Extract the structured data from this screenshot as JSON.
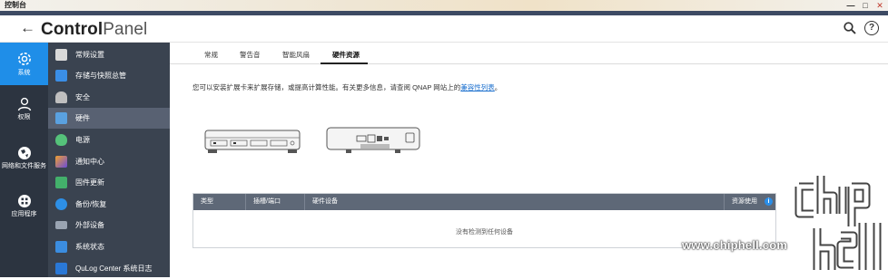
{
  "window": {
    "title": "控制台",
    "minimize": "—",
    "maximize": "□",
    "close": "✕"
  },
  "header": {
    "back_icon": "←",
    "title_bold": "Control",
    "title_light": "Panel",
    "help_label": "?"
  },
  "rail": [
    {
      "label": "系统",
      "icon": "gear-icon",
      "active": true
    },
    {
      "label": "权限",
      "icon": "user-icon",
      "active": false
    },
    {
      "label": "网络和文件服务",
      "icon": "globe-icon",
      "active": false
    },
    {
      "label": "应用程序",
      "icon": "apps-grid-icon",
      "active": false
    }
  ],
  "subnav": [
    {
      "label": "常规设置",
      "icon": "general-settings-icon",
      "color": "#d9d9d9"
    },
    {
      "label": "存储与快照总管",
      "icon": "storage-icon",
      "color": "#3a8ee6"
    },
    {
      "label": "安全",
      "icon": "lock-icon",
      "color": "#bfbfbf"
    },
    {
      "label": "硬件",
      "icon": "hardware-icon",
      "color": "#5aa1e0",
      "active": true
    },
    {
      "label": "电源",
      "icon": "power-icon",
      "color": "#55c27a"
    },
    {
      "label": "通知中心",
      "icon": "notification-icon",
      "color": "#f0a030"
    },
    {
      "label": "固件更新",
      "icon": "firmware-icon",
      "color": "#43b06b"
    },
    {
      "label": "备份/恢复",
      "icon": "backup-icon",
      "color": "#2d8fe6"
    },
    {
      "label": "外部设备",
      "icon": "external-device-icon",
      "color": "#9aa4b2"
    },
    {
      "label": "系统状态",
      "icon": "system-status-icon",
      "color": "#3b8de0"
    },
    {
      "label": "QuLog Center 系统日志",
      "icon": "qulog-icon",
      "color": "#2a78d6"
    }
  ],
  "tabs": [
    {
      "label": "常规",
      "active": false
    },
    {
      "label": "警告音",
      "active": false
    },
    {
      "label": "智能风扇",
      "active": false
    },
    {
      "label": "硬件资源",
      "active": true
    }
  ],
  "main": {
    "description": "您可以安装扩展卡来扩展存储，或提高计算性能。有关更多信息，请查阅 QNAP 网站上的",
    "link_text": "兼容性列表",
    "description_end": "。"
  },
  "table": {
    "columns": [
      "类型",
      "插槽/端口",
      "硬件设备",
      "资源使用"
    ],
    "info_icon": "i",
    "empty_message": "没有检测到任何设备"
  },
  "watermark": {
    "text": "www.chiphell.com",
    "logo": "chip hell"
  },
  "colors": {
    "accent": "#1f8ee8",
    "rail_bg": "#2c3440",
    "subnav_bg": "#3a4350",
    "subnav_active": "#586172",
    "table_header": "#5e6877"
  }
}
